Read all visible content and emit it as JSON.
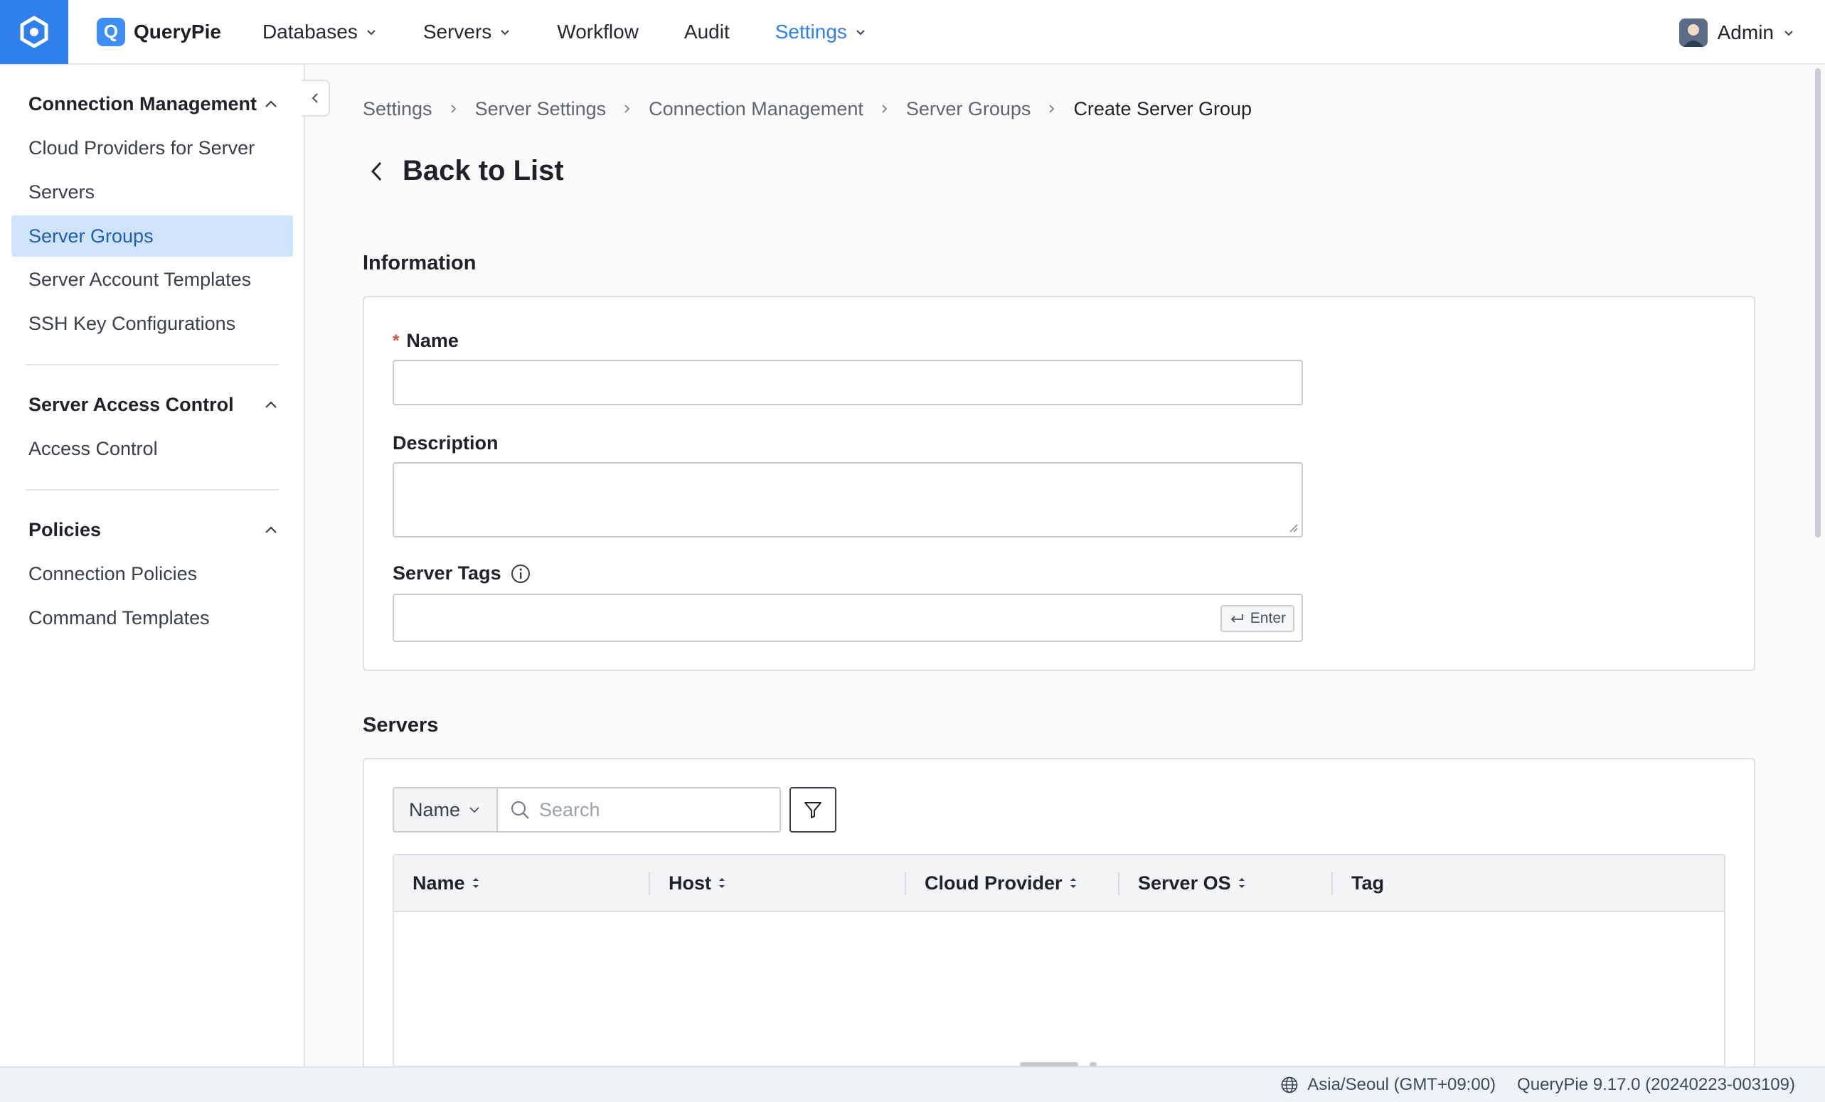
{
  "header": {
    "brand": "QueryPie",
    "nav": [
      {
        "label": "Databases",
        "has_menu": true,
        "active": false
      },
      {
        "label": "Servers",
        "has_menu": true,
        "active": false
      },
      {
        "label": "Workflow",
        "has_menu": false,
        "active": false
      },
      {
        "label": "Audit",
        "has_menu": false,
        "active": false
      },
      {
        "label": "Settings",
        "has_menu": true,
        "active": true
      }
    ],
    "user": "Admin"
  },
  "sidebar": {
    "sections": [
      {
        "title": "Connection Management",
        "items": [
          "Cloud Providers for Server",
          "Servers",
          "Server Groups",
          "Server Account Templates",
          "SSH Key Configurations"
        ]
      },
      {
        "title": "Server Access Control",
        "items": [
          "Access Control"
        ]
      },
      {
        "title": "Policies",
        "items": [
          "Connection Policies",
          "Command Templates"
        ]
      }
    ],
    "active_item": "Server Groups"
  },
  "breadcrumb": [
    "Settings",
    "Server Settings",
    "Connection Management",
    "Server Groups",
    "Create Server Group"
  ],
  "page": {
    "back_label": "Back to List",
    "information_title": "Information",
    "name_label": "Name",
    "name_value": "",
    "description_label": "Description",
    "description_value": "",
    "server_tags_label": "Server Tags",
    "enter_hint": "Enter",
    "servers_title": "Servers",
    "search_field_select": "Name",
    "search_placeholder": "Search",
    "columns": [
      "Name",
      "Host",
      "Cloud Provider",
      "Server OS",
      "Tag"
    ]
  },
  "footer": {
    "timezone": "Asia/Seoul (GMT+09:00)",
    "version": "QueryPie 9.17.0 (20240223-003109)"
  },
  "colors": {
    "accent": "#2f80ed",
    "active_bg": "#cfe3fb",
    "required": "#e5484d"
  }
}
